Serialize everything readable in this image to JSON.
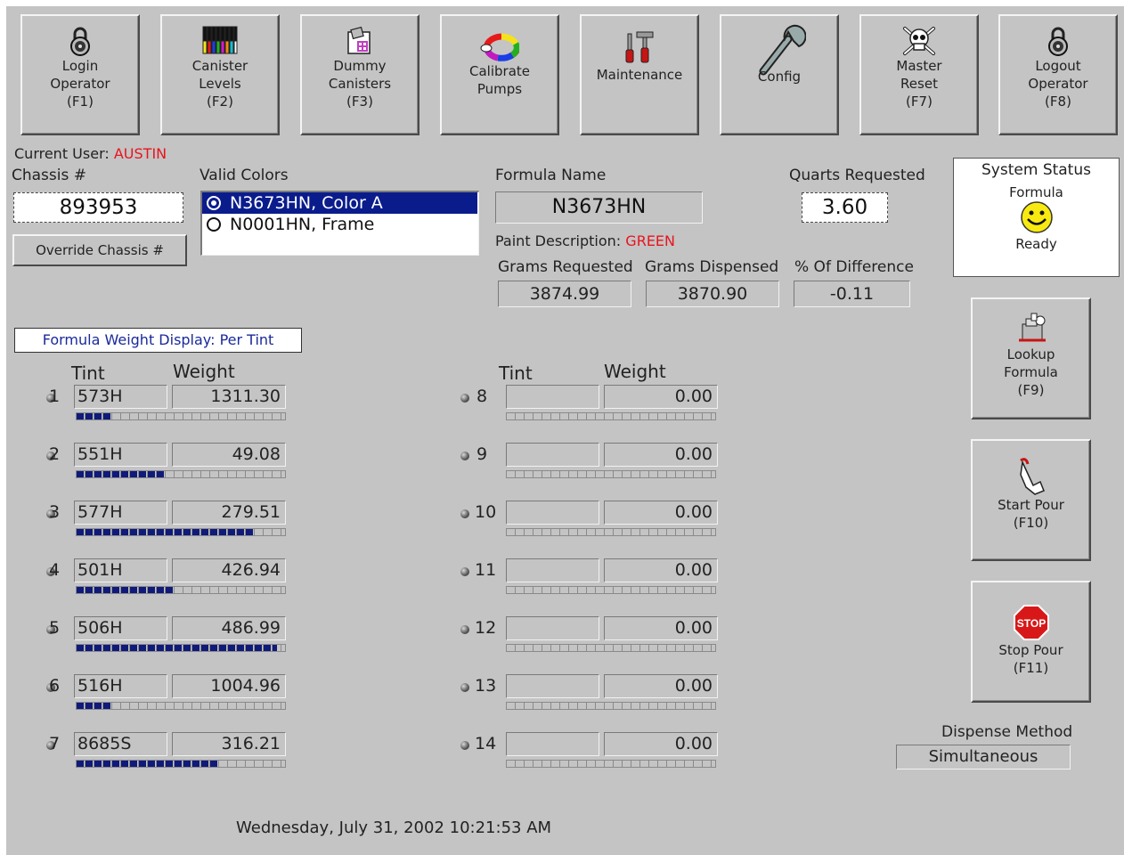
{
  "toolbar": [
    {
      "label": "Login\nOperator\n(F1)",
      "icon": "padlock-icon"
    },
    {
      "label": "Canister\nLevels\n(F2)",
      "icon": "canisters-icon"
    },
    {
      "label": "Dummy\nCanisters\n(F3)",
      "icon": "dummy-canister-icon"
    },
    {
      "label": "Calibrate\nPumps",
      "icon": "color-wheel-icon"
    },
    {
      "label": "Maintenance",
      "icon": "tools-icon"
    },
    {
      "label": "Config",
      "icon": "wrench-icon"
    },
    {
      "label": "Master\nReset\n(F7)",
      "icon": "skull-icon"
    },
    {
      "label": "Logout\nOperator\n(F8)",
      "icon": "padlock-icon"
    }
  ],
  "user": {
    "label": "Current User:",
    "name": "AUSTIN"
  },
  "chassis": {
    "label": "Chassis #",
    "value": "893953",
    "override_label": "Override Chassis #"
  },
  "valid_colors": {
    "label": "Valid Colors",
    "options": [
      {
        "text": "N3673HN, Color A",
        "selected": true
      },
      {
        "text": "N0001HN, Frame",
        "selected": false
      }
    ]
  },
  "formula": {
    "name_label": "Formula Name",
    "name": "N3673HN",
    "paint_desc_label": "Paint Description:",
    "paint_desc": "GREEN"
  },
  "quarts": {
    "label": "Quarts Requested",
    "value": "3.60"
  },
  "grams": {
    "requested_label": "Grams Requested",
    "requested": "3874.99",
    "dispensed_label": "Grams Dispensed",
    "dispensed": "3870.90",
    "diff_label": "% Of Difference",
    "diff": "-0.11"
  },
  "system_status": {
    "title": "System Status",
    "top": "Formula",
    "bottom": "Ready",
    "icon": "smiley-icon"
  },
  "weight_display": "Formula Weight Display: Per Tint",
  "col_headers": {
    "tint": "Tint",
    "weight": "Weight"
  },
  "tints_left": [
    {
      "n": "1",
      "tint": "573H",
      "weight": "1311.30",
      "fill": 0.17
    },
    {
      "n": "2",
      "tint": "551H",
      "weight": "49.08",
      "fill": 0.42
    },
    {
      "n": "3",
      "tint": "577H",
      "weight": "279.51",
      "fill": 0.85
    },
    {
      "n": "4",
      "tint": "501H",
      "weight": "426.94",
      "fill": 0.47
    },
    {
      "n": "5",
      "tint": "506H",
      "weight": "486.99",
      "fill": 0.96
    },
    {
      "n": "6",
      "tint": "516H",
      "weight": "1004.96",
      "fill": 0.17
    },
    {
      "n": "7",
      "tint": "8685S",
      "weight": "316.21",
      "fill": 0.68
    }
  ],
  "tints_right": [
    {
      "n": "8",
      "tint": "",
      "weight": "0.00",
      "fill": 0
    },
    {
      "n": "9",
      "tint": "",
      "weight": "0.00",
      "fill": 0
    },
    {
      "n": "10",
      "tint": "",
      "weight": "0.00",
      "fill": 0
    },
    {
      "n": "11",
      "tint": "",
      "weight": "0.00",
      "fill": 0
    },
    {
      "n": "12",
      "tint": "",
      "weight": "0.00",
      "fill": 0
    },
    {
      "n": "13",
      "tint": "",
      "weight": "0.00",
      "fill": 0
    },
    {
      "n": "14",
      "tint": "",
      "weight": "0.00",
      "fill": 0
    }
  ],
  "side_buttons": [
    {
      "label": "Lookup\nFormula\n(F9)",
      "icon": "lookup-formula-icon"
    },
    {
      "label": "Start Pour\n(F10)",
      "icon": "hand-pointer-icon"
    },
    {
      "label": "Stop Pour\n(F11)",
      "icon": "stop-sign-icon",
      "icon_text": "STOP"
    }
  ],
  "dispense": {
    "label": "Dispense Method",
    "value": "Simultaneous"
  },
  "datetime": "Wednesday, July 31, 2002  10:21:53 AM",
  "colors": {
    "background": "#c4c4c4",
    "accent_red": "#e8141e",
    "selection_blue": "#0a1c8c",
    "bar_fill": "#0f1a7a"
  }
}
